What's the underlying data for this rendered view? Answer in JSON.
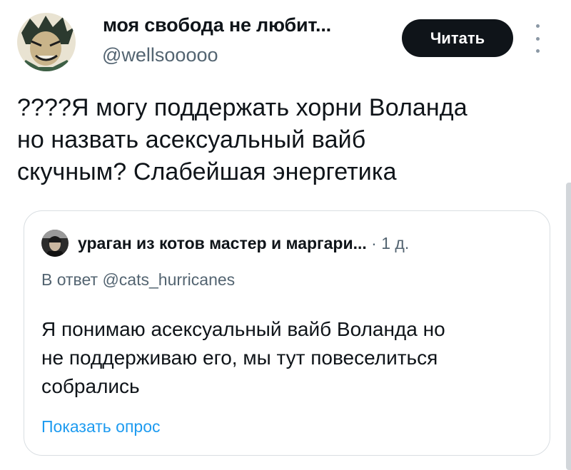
{
  "post": {
    "author": {
      "display_name": "моя свобода не любит...",
      "handle": "@wellsooooo"
    },
    "read_button_label": "Читать",
    "more_icon": "more-vertical-icon",
    "text_lines": [
      "????Я могу поддержать хорни Воланда",
      "но назвать асексуальный вайб",
      "скучным? Слабейшая энергетика"
    ]
  },
  "quoted_post": {
    "author_name": "ураган из котов мастер и маргари...",
    "separator": "·",
    "time": "1 д.",
    "reply_to": "В ответ @cats_hurricanes",
    "text_lines": [
      "Я понимаю асексуальный вайб Воланда но",
      "не поддерживаю его, мы тут повеселиться",
      "собрались"
    ],
    "poll_link": "Показать опрос"
  },
  "colors": {
    "text": "#0f1419",
    "secondary": "#536471",
    "accent": "#1d9bf0",
    "button_bg": "#0f1419",
    "border": "#d9dee2"
  }
}
